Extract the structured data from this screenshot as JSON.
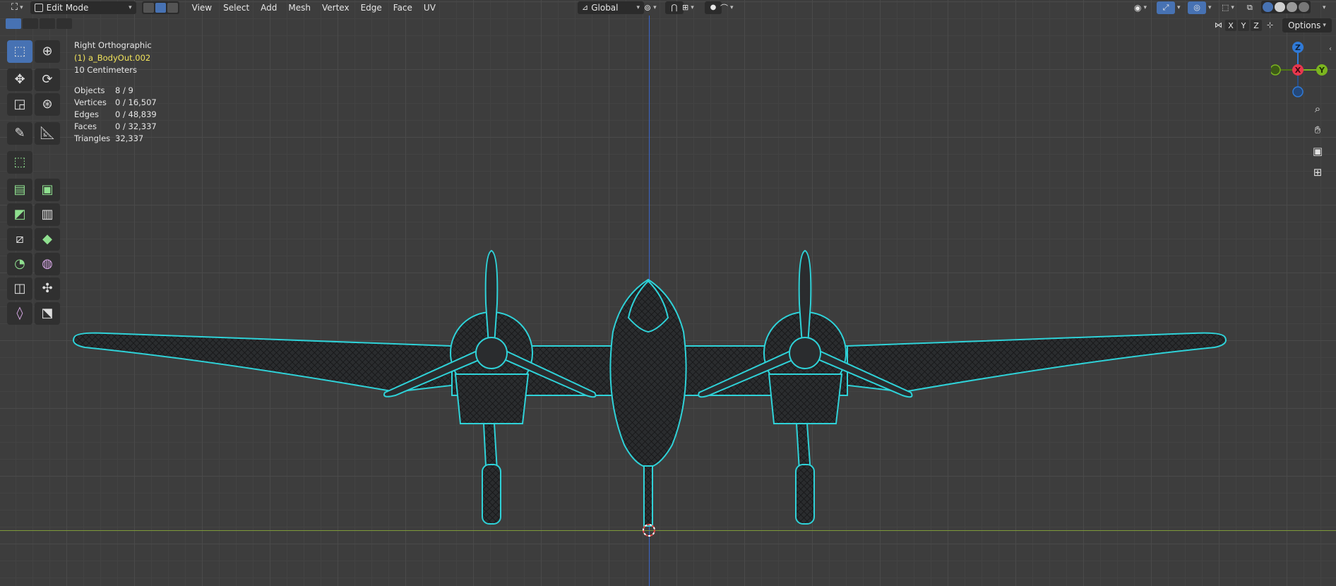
{
  "header": {
    "mode_label": "Edit Mode",
    "menus": [
      "View",
      "Select",
      "Add",
      "Mesh",
      "Vertex",
      "Edge",
      "Face",
      "UV"
    ],
    "transform_orientation": "Global",
    "options_label": "Options",
    "axis_x": "X",
    "axis_y": "Y",
    "axis_z": "Z"
  },
  "overlay": {
    "view_name": "Right Orthographic",
    "active_object": "(1) a_BodyOut.002",
    "grid_scale": "10 Centimeters",
    "stats": [
      {
        "label": "Objects",
        "value": "8 / 9"
      },
      {
        "label": "Vertices",
        "value": "0 / 16,507"
      },
      {
        "label": "Edges",
        "value": "0 / 48,839"
      },
      {
        "label": "Faces",
        "value": "0 / 32,337"
      },
      {
        "label": "Triangles",
        "value": "32,337"
      }
    ]
  },
  "gizmo": {
    "z": "Z",
    "x": "X",
    "y": "Y"
  },
  "colors": {
    "accent": "#4772b3",
    "wire": "#2fd2d8",
    "mesh_dark": "#1e1f20",
    "axis_z": "#3a66c9",
    "axis_y": "#7e9a3a",
    "gizmo_x": "#e8374d",
    "gizmo_y": "#7bb51f",
    "gizmo_z": "#2f7ad8",
    "active_text": "#f2e45c"
  }
}
